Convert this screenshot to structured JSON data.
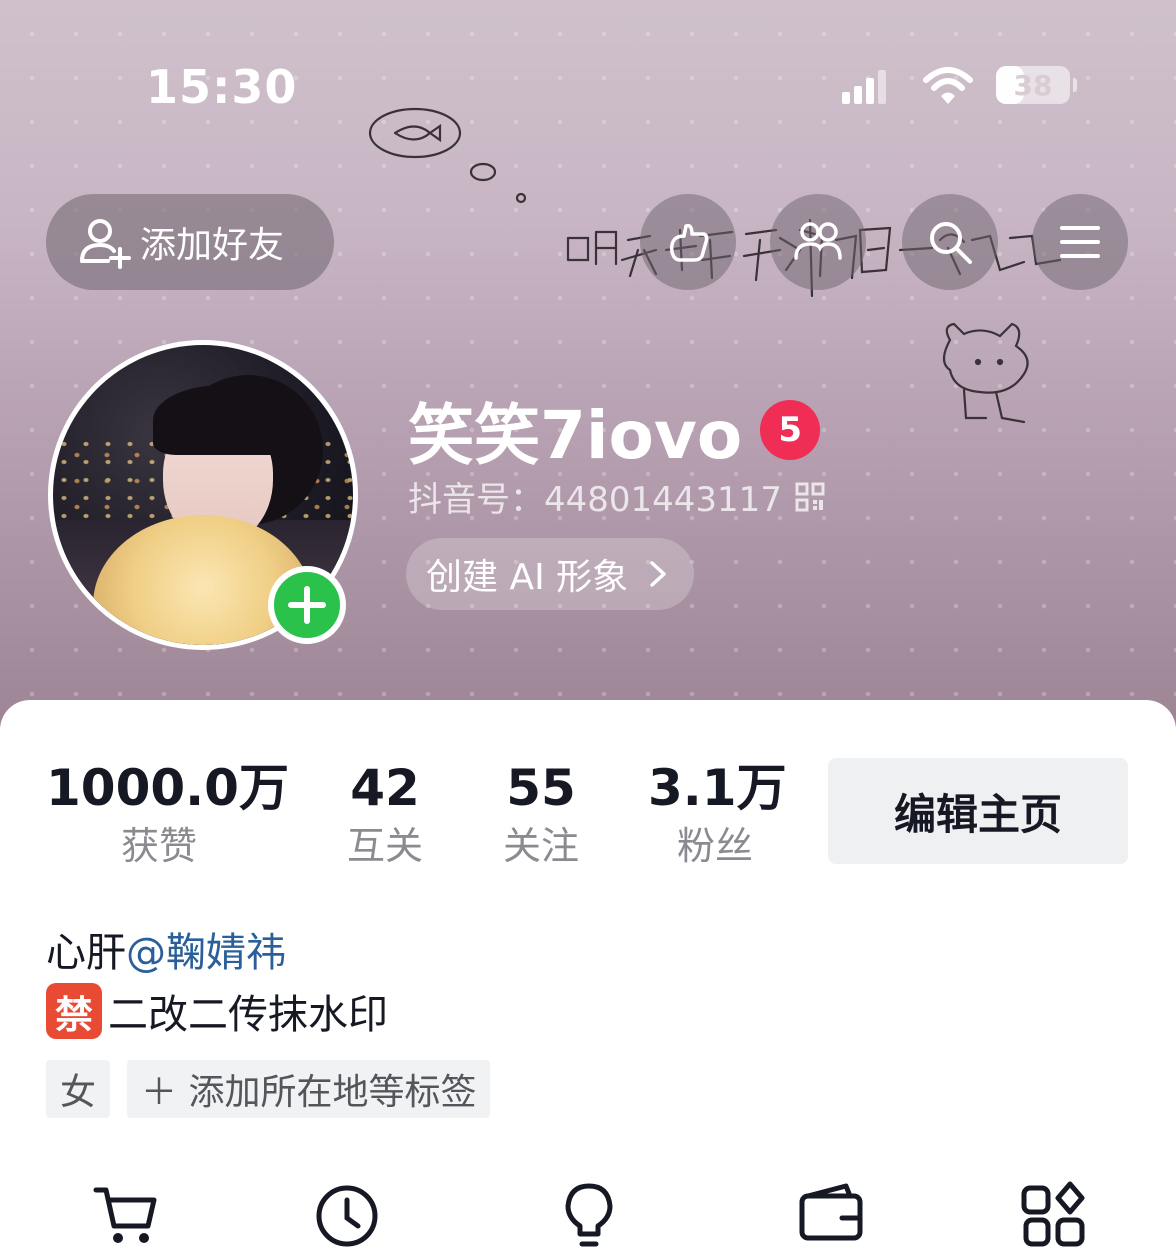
{
  "status_bar": {
    "time": "15:30",
    "battery": "38",
    "battery_level": 0.38,
    "icons": [
      "signal-icon",
      "wifi-icon",
      "battery-icon"
    ]
  },
  "header": {
    "add_friend_label": "添加好友",
    "round_buttons": [
      "visitor-icon",
      "friends-icon",
      "search-icon",
      "menu-icon"
    ]
  },
  "profile": {
    "name": "笑笑7iovo",
    "badge": "5",
    "douyin_id": "抖音号：44801443117",
    "ai_button": "创建 AI 形象"
  },
  "stats": [
    {
      "value": "1000.0万",
      "label": "获赞"
    },
    {
      "value": "42",
      "label": "互关"
    },
    {
      "value": "55",
      "label": "关注"
    },
    {
      "value": "3.1万",
      "label": "粉丝"
    }
  ],
  "edit_label": "编辑主页",
  "bio": {
    "line1_prefix": "心肝",
    "mention": "@鞠婧祎",
    "ban_emoji": "禁",
    "line2": "二改二传抹水印"
  },
  "tags": [
    "女",
    "＋ 添加所在地等标签"
  ],
  "bottom_icons": [
    "cart-icon",
    "clock-icon",
    "lightbulb-icon",
    "wallet-icon",
    "apps-icon"
  ],
  "colors": {
    "accent_green": "#2bc24c",
    "badge_red": "#f02d54",
    "mention_blue": "#2a5f99"
  }
}
